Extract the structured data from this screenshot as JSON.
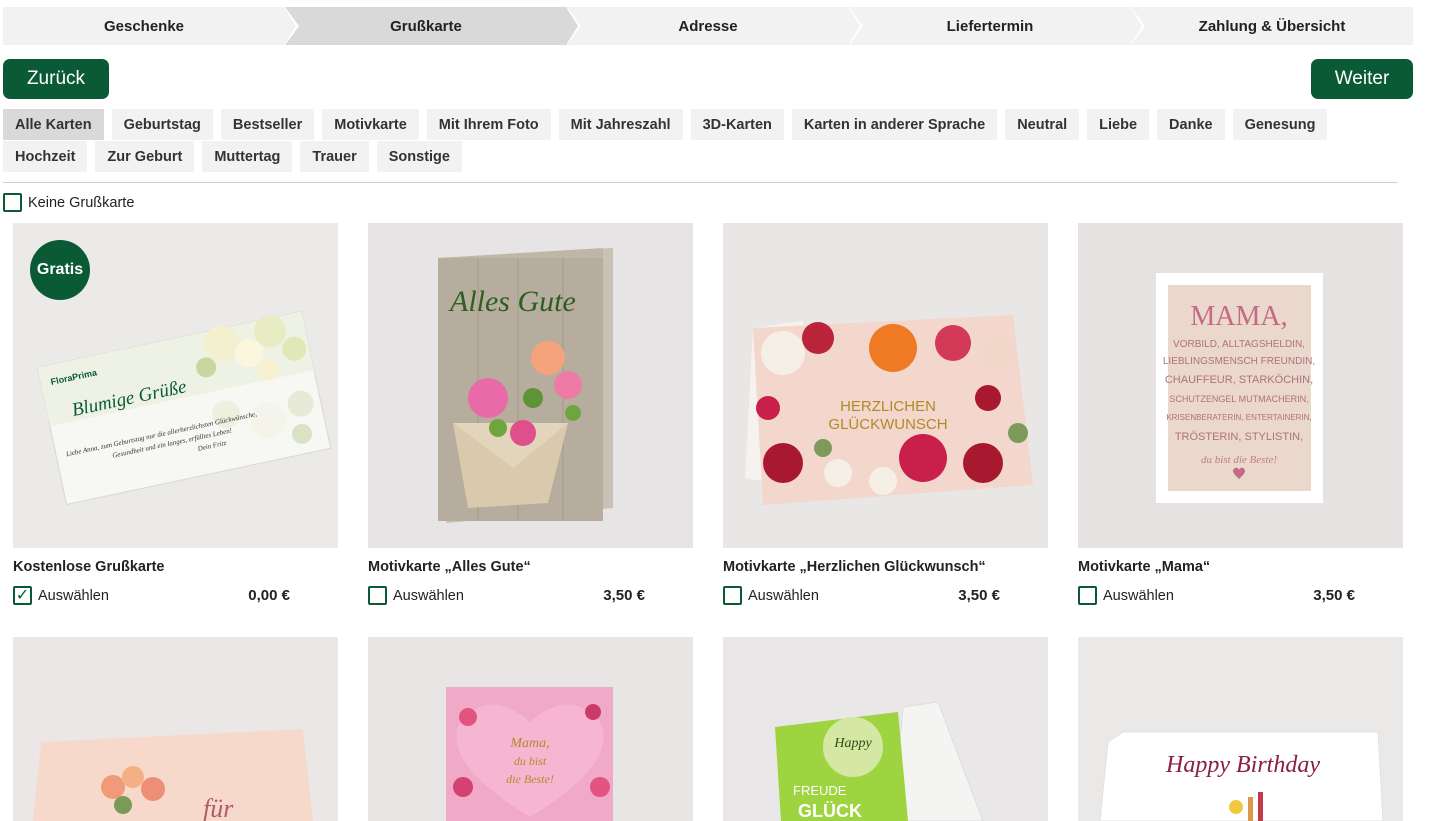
{
  "steps": [
    "Geschenke",
    "Grußkarte",
    "Adresse",
    "Liefertermin",
    "Zahlung & Übersicht"
  ],
  "nav": {
    "back_label": "Zurück",
    "next_label": "Weiter"
  },
  "filters": {
    "row1": [
      "Alle Karten",
      "Geburtstag",
      "Bestseller",
      "Motivkarte",
      "Mit Ihrem Foto",
      "Mit Jahreszahl",
      "3D-Karten",
      "Karten in anderer Sprache",
      "Neutral",
      "Liebe",
      "Danke",
      "Genesung"
    ],
    "row2": [
      "Hochzeit",
      "Zur Geburt",
      "Muttertag",
      "Trauer",
      "Sonstige"
    ],
    "active": "Alle Karten"
  },
  "no_card_label": "Keine Grußkarte",
  "products": [
    {
      "title": "Kostenlose Grußkarte",
      "select_label": "Auswählen",
      "price": "0,00 €",
      "selected": true,
      "badge": "Gratis",
      "card_text": {
        "logo": "FloraPrima",
        "heading": "Blumige Grüße",
        "line1": "Liebe Anna, zum Geburtstag nur die allerherzlichsten Glückwünsche,",
        "line2": "Gesundheit und ein langes, erfülltes Leben!",
        "line3": "Dein Fritz"
      }
    },
    {
      "title": "Motivkarte „Alles Gute“",
      "select_label": "Auswählen",
      "price": "3,50 €",
      "selected": false,
      "card_text": {
        "heading": "Alles Gute"
      }
    },
    {
      "title": "Motivkarte „Herzlichen Glückwunsch“",
      "select_label": "Auswählen",
      "price": "3,50 €",
      "selected": false,
      "card_text": {
        "line1": "HERZLICHEN",
        "line2": "GLÜCKWUNSCH"
      }
    },
    {
      "title": "Motivkarte „Mama“",
      "select_label": "Auswählen",
      "price": "3,50 €",
      "selected": false,
      "card_text": {
        "heading": "MAMA,",
        "lines": [
          "VORBILD, ALLTAGSHELDIN,",
          "LIEBLINGSMENSCH FREUNDIN,",
          "CHAUFFEUR, STARKÖCHIN,",
          "SCHUTZENGEL MUTMACHERIN,",
          "KRISENBERATERIN, ENTERTAINERIN,",
          "TRÖSTERIN, STYLISTIN,"
        ],
        "closing": "du bist die Beste!"
      }
    }
  ],
  "row2_cards": [
    {
      "card_text": "für"
    },
    {
      "card_text": {
        "line1": "Mama,",
        "line2": "du bist",
        "line3": "die Beste!"
      }
    },
    {
      "card_text": {
        "line1": "Happy",
        "line2": "FREUDE",
        "line3": "GLÜCK"
      }
    },
    {
      "card_text": "Happy Birthday"
    }
  ],
  "colors": {
    "brand": "#0b5a36",
    "step_bg": "#f2f2f2",
    "step_active": "#d9d9d9"
  }
}
